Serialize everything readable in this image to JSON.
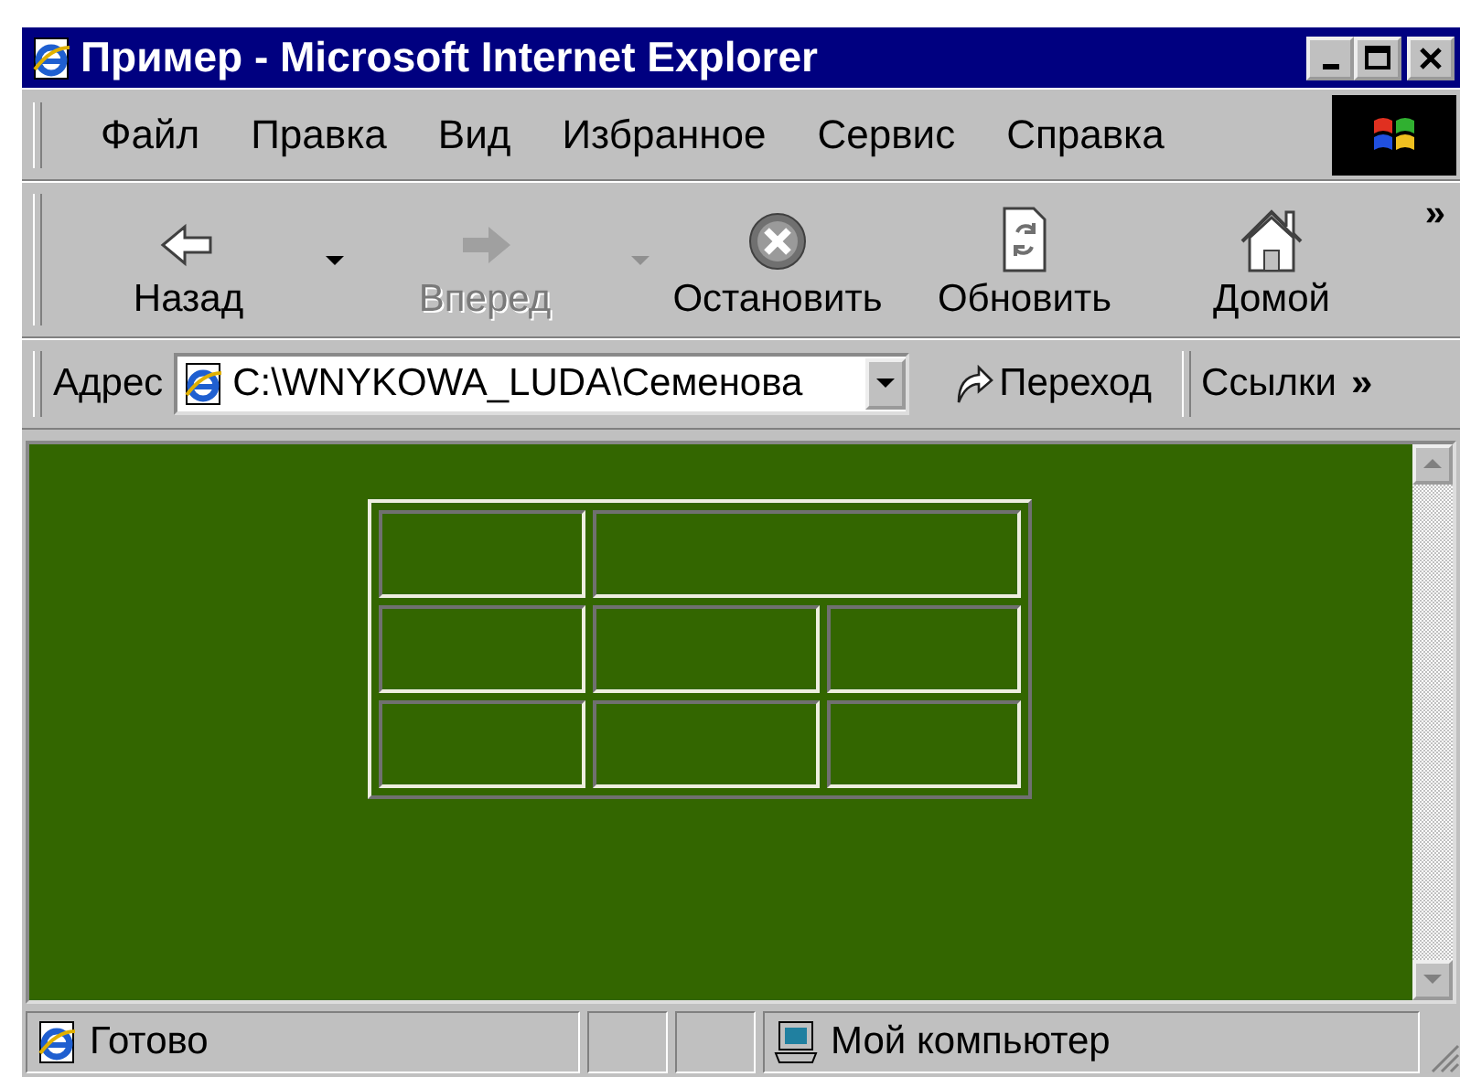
{
  "window": {
    "title": "Пример - Microsoft Internet Explorer"
  },
  "menu": [
    {
      "label": "Файл"
    },
    {
      "label": "Правка"
    },
    {
      "label": "Вид"
    },
    {
      "label": "Избранное"
    },
    {
      "label": "Сервис"
    },
    {
      "label": "Справка"
    }
  ],
  "toolbar": {
    "buttons": [
      {
        "kind": "back",
        "label": "Назад",
        "disabled": false,
        "has_dropdown": true
      },
      {
        "kind": "forward",
        "label": "Вперед",
        "disabled": true,
        "has_dropdown": true
      },
      {
        "kind": "stop",
        "label": "Остановить",
        "disabled": false,
        "has_dropdown": false
      },
      {
        "kind": "refresh",
        "label": "Обновить",
        "disabled": false,
        "has_dropdown": false
      },
      {
        "kind": "home",
        "label": "Домой",
        "disabled": false,
        "has_dropdown": false
      }
    ],
    "more": "»"
  },
  "address_bar": {
    "label": "Адрес",
    "value": "C:\\WNYKOWA_LUDA\\Семенова",
    "go": "Переход",
    "links": "Ссылки",
    "more": "»"
  },
  "content": {
    "table": {
      "rows": [
        [
          {
            "kind": "single"
          },
          {
            "kind": "double"
          }
        ],
        [
          {
            "kind": "single"
          },
          {
            "kind": "single"
          },
          {
            "kind": "single"
          }
        ],
        [
          {
            "kind": "single"
          },
          {
            "kind": "single"
          },
          {
            "kind": "single"
          }
        ]
      ]
    }
  },
  "status_bar": {
    "text": "Готово",
    "zone": "Мой компьютер"
  }
}
